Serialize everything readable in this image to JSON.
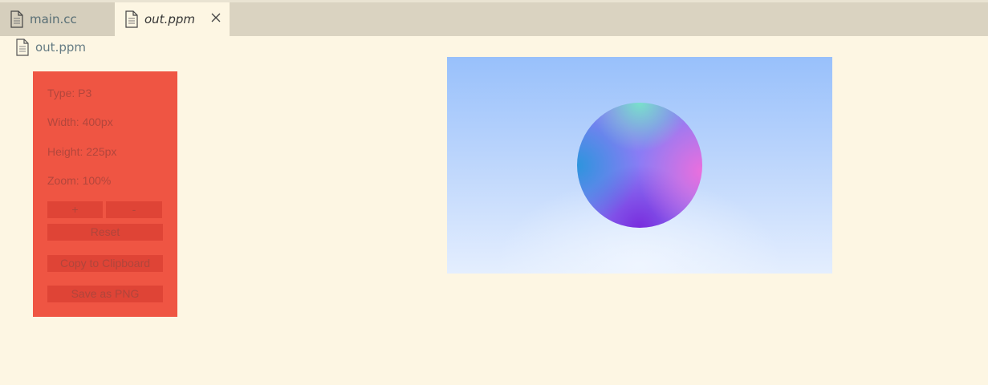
{
  "tabs": [
    {
      "label": "main.cc",
      "icon": "file-icon"
    },
    {
      "label": "out.ppm",
      "icon": "file-icon",
      "active": true
    }
  ],
  "breadcrumb": {
    "label": "out.ppm",
    "icon": "file-icon"
  },
  "panel": {
    "type": "Type: P3",
    "width": "Width: 400px",
    "height": "Height: 225px",
    "zoom": "Zoom: 100%",
    "zoom_in_label": "+",
    "zoom_out_label": "-",
    "reset_label": "Reset",
    "copy_label": "Copy to Clipboard",
    "save_label": "Save as PNG"
  },
  "colors": {
    "background": "#fdf6e3",
    "tabbar": "#dad3c1",
    "panel": "#ef5543",
    "panel_button": "#df4436"
  }
}
